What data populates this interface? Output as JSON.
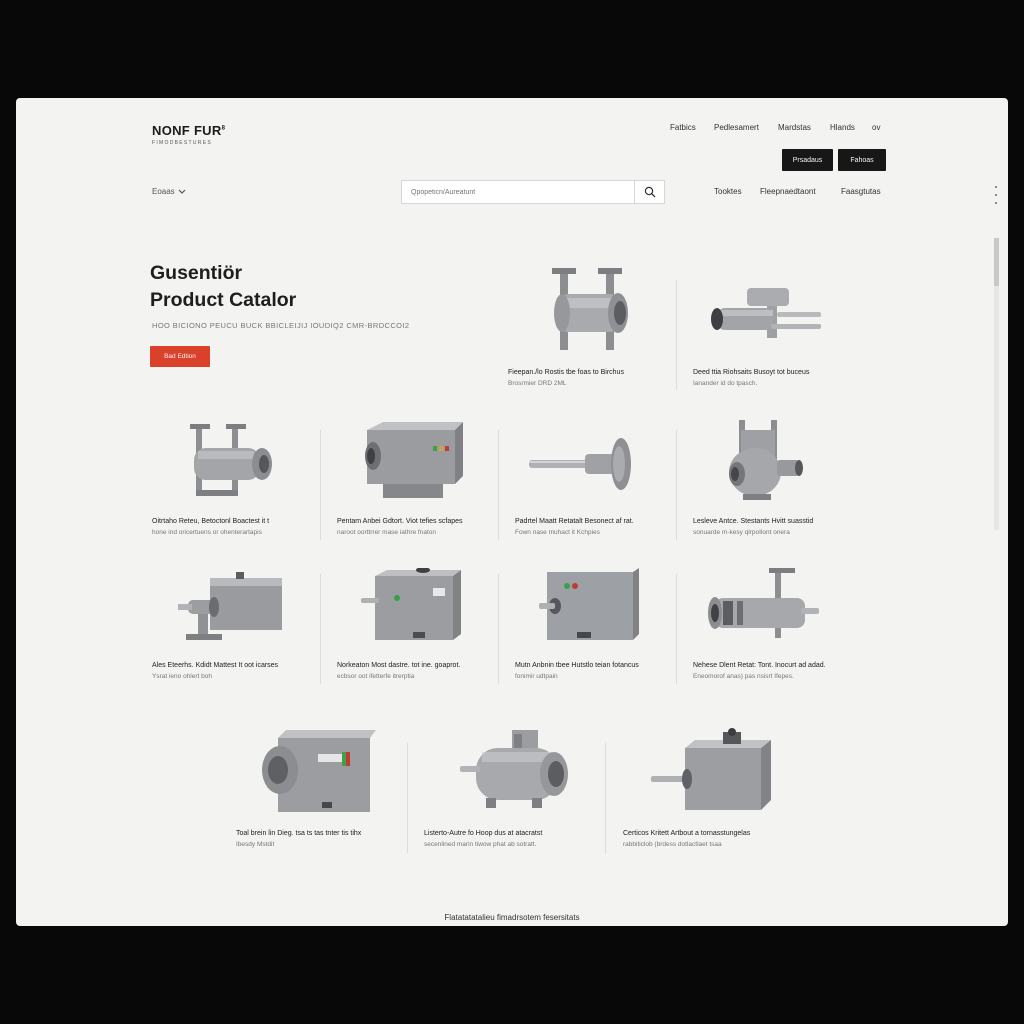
{
  "brand": {
    "name": "NONF FUR",
    "mark": "8",
    "tagline": "FIMODBESTURES"
  },
  "top_nav": [
    "Fatbics",
    "Pedlesamert",
    "Mardstas",
    "Hlands",
    "ov"
  ],
  "top_buttons": [
    "Prsadaus",
    "Fahoas"
  ],
  "locale": "Eoaas",
  "search": {
    "placeholder": "Qpopeticn/Aureatunt"
  },
  "sub_nav": [
    "Tooktes",
    "Fleepnaedtaont",
    "Faasgtutas"
  ],
  "hero": {
    "title_line1": "Gusentiör",
    "title_line2": "Product Catalor",
    "description": "HOO BICIONO PEUCU BUCK BBICLEIJIJ IOUDIQ2 CMR-BRDCCOI2",
    "cta": "Bad Edtion"
  },
  "products": [
    {
      "name": "Fieepan./lo Rostis tbe foas to Birchus",
      "meta": "Brosrmier DRD 2ML",
      "icon": "flanged-pipe-icon"
    },
    {
      "name": "Deed ttia Riohsaits Busoyt tot buceus",
      "meta": "Ianander id do tpasch.",
      "icon": "piston-rod-icon"
    },
    {
      "name": "Oitrtaho Reteu, Betoctonl Boactest it t",
      "meta": "hone ind oricertuens or ohenterartapis",
      "icon": "flanged-pump-icon"
    },
    {
      "name": "Pentam Anbei Gdtort. Viot tefies scfapes",
      "meta": "naroot oorttrrer mase iathre fnaton",
      "icon": "gearbox-icon"
    },
    {
      "name": "Padrtel Maatt Retatalt Besonect af rat.",
      "meta": "Fown nase muhact it Kchpies",
      "icon": "shaft-flange-icon"
    },
    {
      "name": "Lesleve Antce. Stestants Hvitt suasstid",
      "meta": "sonuarde m-kesy qlrpoIlont onera",
      "icon": "pump-housing-icon"
    },
    {
      "name": "Ales Eteerhs. Kdidt Mattest It oot icarses",
      "meta": "Ysrat ieno ohlert boh",
      "icon": "motor-block-icon"
    },
    {
      "name": "Norkeaton Most dastre. tot ine. goaprot.",
      "meta": "ecbsor oot ifetterfe itrerptia",
      "icon": "control-box-icon"
    },
    {
      "name": "Mutn Anbnin tbee Hutstlo teian fotancus",
      "meta": "fonimir udtpain",
      "icon": "drive-unit-icon"
    },
    {
      "name": "Nehese Dlent Retat: Tont. Inocurt ad adad.",
      "meta": "Eneomorof anas) pas nsisrt Ifepes.",
      "icon": "actuator-icon"
    },
    {
      "name": "Toal brein lin Dieg. tsa ts tas tnter tis tihx",
      "meta": "Ibesdy Mstdit",
      "icon": "coupling-unit-icon"
    },
    {
      "name": "Listerto-Autre fo Hoop dus at atacratst",
      "meta": "secenlined marin tiwow phat ab sotratt.",
      "icon": "centrifugal-pump-icon"
    },
    {
      "name": "Certicos Kritett Artbout a tornasstungelas",
      "meta": "rabbiticlob (brdess dotlactlaet tsaa",
      "icon": "motor-cube-icon"
    }
  ],
  "footer": {
    "link": "Flatatatatalieu fimadrsotem fesersitats"
  },
  "colors": {
    "accent": "#d9412b",
    "dark_button": "#171717",
    "background": "#f3f3f2",
    "metal": "#9a9ca0"
  }
}
